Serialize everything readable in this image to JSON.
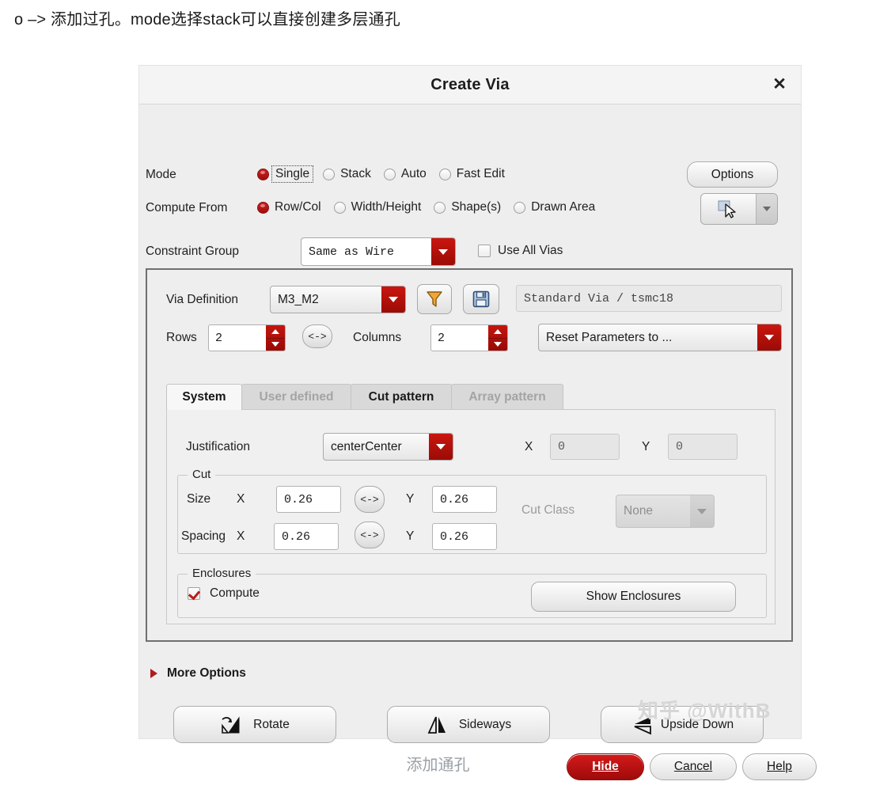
{
  "page": {
    "note": "o –> 添加过孔。mode选择stack可以直接创建多层通孔",
    "caption": "添加通孔",
    "watermark": "知乎 @WithB"
  },
  "dialog": {
    "title": "Create Via",
    "close_icon": "close-icon"
  },
  "mode": {
    "label": "Mode",
    "options": [
      {
        "label": "Single",
        "selected": true,
        "focused": true
      },
      {
        "label": "Stack",
        "selected": false
      },
      {
        "label": "Auto",
        "selected": false
      },
      {
        "label": "Fast Edit",
        "selected": false
      }
    ],
    "options_button": "Options"
  },
  "compute_from": {
    "label": "Compute From",
    "options": [
      {
        "label": "Row/Col",
        "selected": true
      },
      {
        "label": "Width/Height",
        "selected": false
      },
      {
        "label": "Shape(s)",
        "selected": false
      },
      {
        "label": "Drawn Area",
        "selected": false
      }
    ],
    "tool_icon": "pointer-select-icon",
    "tool_dropdown_icon": "chevron-down-icon"
  },
  "constraint_group": {
    "label": "Constraint Group",
    "value": "Same as Wire",
    "use_all_vias": {
      "label": "Use All Vias",
      "checked": false
    }
  },
  "via_definition": {
    "label": "Via Definition",
    "value": "M3_M2",
    "filter_icon": "filter-funnel-icon",
    "save_icon": "save-floppy-icon",
    "info": "Standard Via / tsmc18"
  },
  "grid": {
    "rows_label": "Rows",
    "rows_value": "2",
    "swap_label": "<->",
    "columns_label": "Columns",
    "columns_value": "2",
    "reset_label": "Reset Parameters to ..."
  },
  "tabs": [
    {
      "label": "System",
      "state": "active"
    },
    {
      "label": "User defined",
      "state": "disabled"
    },
    {
      "label": "Cut pattern",
      "state": "idle"
    },
    {
      "label": "Array pattern",
      "state": "disabled"
    }
  ],
  "justification": {
    "label": "Justification",
    "value": "centerCenter",
    "x_label": "X",
    "x_value": "0",
    "y_label": "Y",
    "y_value": "0"
  },
  "cut": {
    "group_label": "Cut",
    "size_label": "Size",
    "size_x_label": "X",
    "size_x_value": "0.26",
    "size_swap": "<->",
    "size_y_label": "Y",
    "size_y_value": "0.26",
    "spacing_label": "Spacing",
    "spacing_x_label": "X",
    "spacing_x_value": "0.26",
    "spacing_swap": "<->",
    "spacing_y_label": "Y",
    "spacing_y_value": "0.26",
    "cut_class_label": "Cut Class",
    "cut_class_value": "None"
  },
  "enclosures": {
    "group_label": "Enclosures",
    "compute": {
      "label": "Compute",
      "checked": true
    },
    "show_button": "Show Enclosures"
  },
  "more_options": {
    "label": "More Options",
    "arrow_icon": "triangle-right-icon"
  },
  "transform_buttons": [
    {
      "label": "Rotate",
      "icon": "rotate-icon"
    },
    {
      "label": "Sideways",
      "icon": "mirror-vertical-icon"
    },
    {
      "label": "Upside Down",
      "icon": "mirror-horizontal-icon"
    }
  ],
  "footer": {
    "hide": {
      "label": "Hide",
      "accel": "H"
    },
    "cancel": {
      "label": "Cancel",
      "accel": "C"
    },
    "help": {
      "label": "Help",
      "accel": "H"
    }
  },
  "colors": {
    "accent_red": "#b01c1c",
    "combo_arrow_red": "#9b0b06",
    "dialog_bg": "#eeeeee",
    "titlebar_bg": "#f4f4f4"
  }
}
